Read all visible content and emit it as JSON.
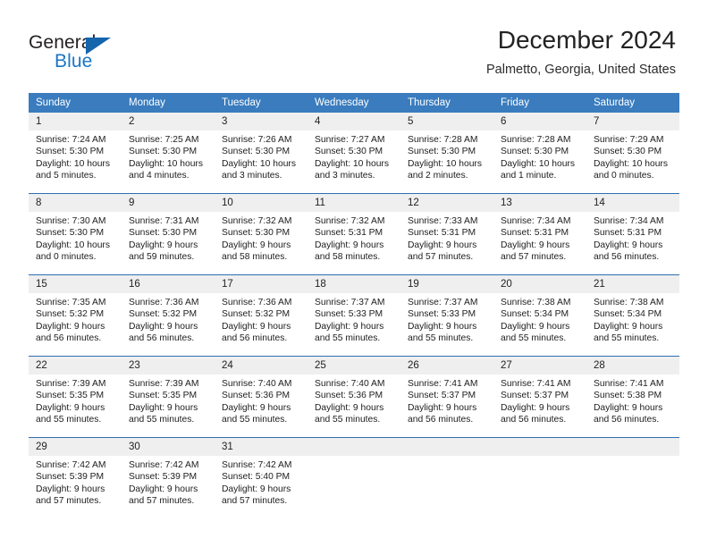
{
  "brand": {
    "name_part1": "General",
    "name_part2": "Blue",
    "triangle_icon": "triangle-icon",
    "accent_color": "#1a76c6",
    "triangle_color": "#1565ac"
  },
  "header": {
    "title": "December 2024",
    "subtitle": "Palmetto, Georgia, United States"
  },
  "calendar": {
    "header_bg": "#3a7cbe",
    "daynum_bg": "#efefef",
    "week_divider_color": "#2f6eb0",
    "weekday_headers": [
      "Sunday",
      "Monday",
      "Tuesday",
      "Wednesday",
      "Thursday",
      "Friday",
      "Saturday"
    ],
    "weeks": [
      [
        {
          "day": "1",
          "sunrise": "Sunrise: 7:24 AM",
          "sunset": "Sunset: 5:30 PM",
          "daylight": "Daylight: 10 hours and 5 minutes."
        },
        {
          "day": "2",
          "sunrise": "Sunrise: 7:25 AM",
          "sunset": "Sunset: 5:30 PM",
          "daylight": "Daylight: 10 hours and 4 minutes."
        },
        {
          "day": "3",
          "sunrise": "Sunrise: 7:26 AM",
          "sunset": "Sunset: 5:30 PM",
          "daylight": "Daylight: 10 hours and 3 minutes."
        },
        {
          "day": "4",
          "sunrise": "Sunrise: 7:27 AM",
          "sunset": "Sunset: 5:30 PM",
          "daylight": "Daylight: 10 hours and 3 minutes."
        },
        {
          "day": "5",
          "sunrise": "Sunrise: 7:28 AM",
          "sunset": "Sunset: 5:30 PM",
          "daylight": "Daylight: 10 hours and 2 minutes."
        },
        {
          "day": "6",
          "sunrise": "Sunrise: 7:28 AM",
          "sunset": "Sunset: 5:30 PM",
          "daylight": "Daylight: 10 hours and 1 minute."
        },
        {
          "day": "7",
          "sunrise": "Sunrise: 7:29 AM",
          "sunset": "Sunset: 5:30 PM",
          "daylight": "Daylight: 10 hours and 0 minutes."
        }
      ],
      [
        {
          "day": "8",
          "sunrise": "Sunrise: 7:30 AM",
          "sunset": "Sunset: 5:30 PM",
          "daylight": "Daylight: 10 hours and 0 minutes."
        },
        {
          "day": "9",
          "sunrise": "Sunrise: 7:31 AM",
          "sunset": "Sunset: 5:30 PM",
          "daylight": "Daylight: 9 hours and 59 minutes."
        },
        {
          "day": "10",
          "sunrise": "Sunrise: 7:32 AM",
          "sunset": "Sunset: 5:30 PM",
          "daylight": "Daylight: 9 hours and 58 minutes."
        },
        {
          "day": "11",
          "sunrise": "Sunrise: 7:32 AM",
          "sunset": "Sunset: 5:31 PM",
          "daylight": "Daylight: 9 hours and 58 minutes."
        },
        {
          "day": "12",
          "sunrise": "Sunrise: 7:33 AM",
          "sunset": "Sunset: 5:31 PM",
          "daylight": "Daylight: 9 hours and 57 minutes."
        },
        {
          "day": "13",
          "sunrise": "Sunrise: 7:34 AM",
          "sunset": "Sunset: 5:31 PM",
          "daylight": "Daylight: 9 hours and 57 minutes."
        },
        {
          "day": "14",
          "sunrise": "Sunrise: 7:34 AM",
          "sunset": "Sunset: 5:31 PM",
          "daylight": "Daylight: 9 hours and 56 minutes."
        }
      ],
      [
        {
          "day": "15",
          "sunrise": "Sunrise: 7:35 AM",
          "sunset": "Sunset: 5:32 PM",
          "daylight": "Daylight: 9 hours and 56 minutes."
        },
        {
          "day": "16",
          "sunrise": "Sunrise: 7:36 AM",
          "sunset": "Sunset: 5:32 PM",
          "daylight": "Daylight: 9 hours and 56 minutes."
        },
        {
          "day": "17",
          "sunrise": "Sunrise: 7:36 AM",
          "sunset": "Sunset: 5:32 PM",
          "daylight": "Daylight: 9 hours and 56 minutes."
        },
        {
          "day": "18",
          "sunrise": "Sunrise: 7:37 AM",
          "sunset": "Sunset: 5:33 PM",
          "daylight": "Daylight: 9 hours and 55 minutes."
        },
        {
          "day": "19",
          "sunrise": "Sunrise: 7:37 AM",
          "sunset": "Sunset: 5:33 PM",
          "daylight": "Daylight: 9 hours and 55 minutes."
        },
        {
          "day": "20",
          "sunrise": "Sunrise: 7:38 AM",
          "sunset": "Sunset: 5:34 PM",
          "daylight": "Daylight: 9 hours and 55 minutes."
        },
        {
          "day": "21",
          "sunrise": "Sunrise: 7:38 AM",
          "sunset": "Sunset: 5:34 PM",
          "daylight": "Daylight: 9 hours and 55 minutes."
        }
      ],
      [
        {
          "day": "22",
          "sunrise": "Sunrise: 7:39 AM",
          "sunset": "Sunset: 5:35 PM",
          "daylight": "Daylight: 9 hours and 55 minutes."
        },
        {
          "day": "23",
          "sunrise": "Sunrise: 7:39 AM",
          "sunset": "Sunset: 5:35 PM",
          "daylight": "Daylight: 9 hours and 55 minutes."
        },
        {
          "day": "24",
          "sunrise": "Sunrise: 7:40 AM",
          "sunset": "Sunset: 5:36 PM",
          "daylight": "Daylight: 9 hours and 55 minutes."
        },
        {
          "day": "25",
          "sunrise": "Sunrise: 7:40 AM",
          "sunset": "Sunset: 5:36 PM",
          "daylight": "Daylight: 9 hours and 55 minutes."
        },
        {
          "day": "26",
          "sunrise": "Sunrise: 7:41 AM",
          "sunset": "Sunset: 5:37 PM",
          "daylight": "Daylight: 9 hours and 56 minutes."
        },
        {
          "day": "27",
          "sunrise": "Sunrise: 7:41 AM",
          "sunset": "Sunset: 5:37 PM",
          "daylight": "Daylight: 9 hours and 56 minutes."
        },
        {
          "day": "28",
          "sunrise": "Sunrise: 7:41 AM",
          "sunset": "Sunset: 5:38 PM",
          "daylight": "Daylight: 9 hours and 56 minutes."
        }
      ],
      [
        {
          "day": "29",
          "sunrise": "Sunrise: 7:42 AM",
          "sunset": "Sunset: 5:39 PM",
          "daylight": "Daylight: 9 hours and 57 minutes."
        },
        {
          "day": "30",
          "sunrise": "Sunrise: 7:42 AM",
          "sunset": "Sunset: 5:39 PM",
          "daylight": "Daylight: 9 hours and 57 minutes."
        },
        {
          "day": "31",
          "sunrise": "Sunrise: 7:42 AM",
          "sunset": "Sunset: 5:40 PM",
          "daylight": "Daylight: 9 hours and 57 minutes."
        },
        {
          "day": "",
          "sunrise": "",
          "sunset": "",
          "daylight": ""
        },
        {
          "day": "",
          "sunrise": "",
          "sunset": "",
          "daylight": ""
        },
        {
          "day": "",
          "sunrise": "",
          "sunset": "",
          "daylight": ""
        },
        {
          "day": "",
          "sunrise": "",
          "sunset": "",
          "daylight": ""
        }
      ]
    ]
  }
}
